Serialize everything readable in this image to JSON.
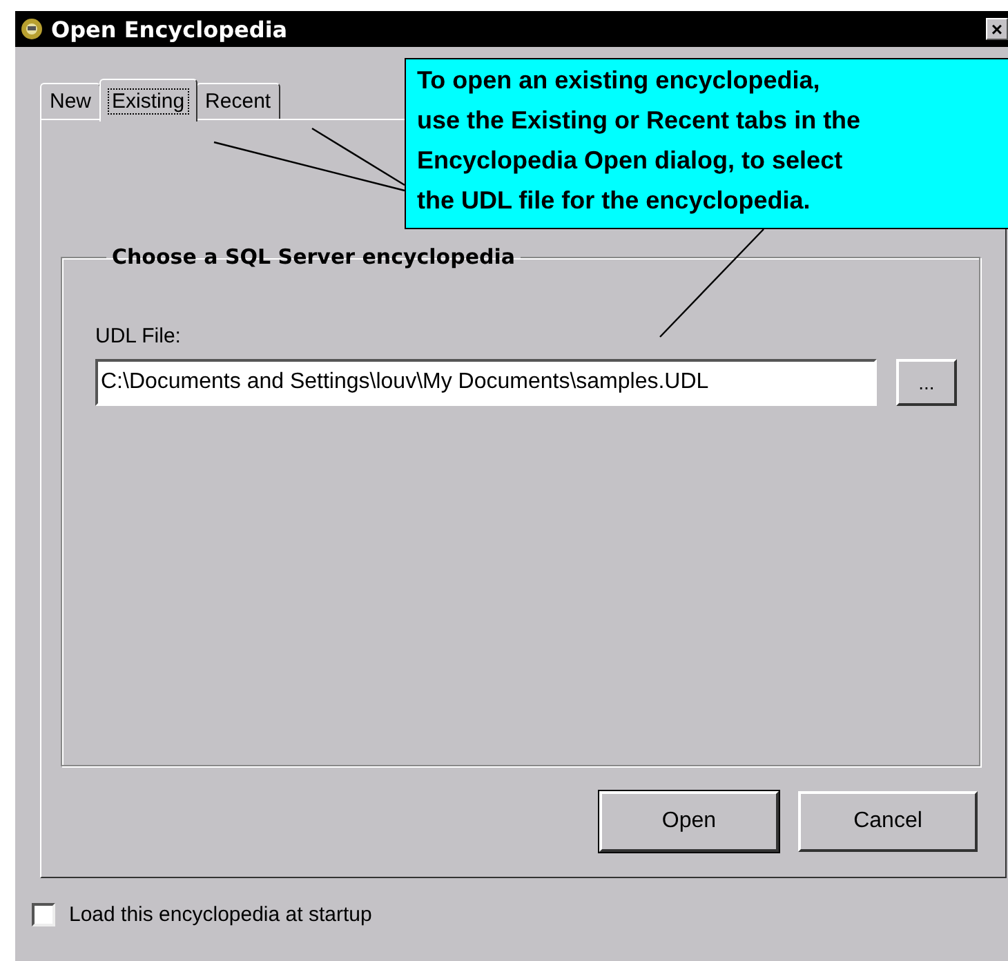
{
  "window": {
    "title": "Open Encyclopedia",
    "close": "×"
  },
  "tabs": [
    {
      "label": "New",
      "selected": false
    },
    {
      "label": "Existing",
      "selected": true
    },
    {
      "label": "Recent",
      "selected": false
    }
  ],
  "callout": {
    "text": "To open an existing encyclopedia,\nuse the Existing or Recent tabs in the\nEncyclopedia Open dialog, to select\nthe UDL file for the encyclopedia."
  },
  "group": {
    "title": "Choose a SQL Server encyclopedia",
    "field_label": "UDL File:",
    "value": "C:\\Documents and Settings\\louv\\My Documents\\samples.UDL",
    "browse": "..."
  },
  "buttons": [
    {
      "label": "Open",
      "default": true
    },
    {
      "label": "Cancel",
      "default": false
    }
  ],
  "startup_checkbox": {
    "label": "Load this encyclopedia at startup",
    "checked": false
  }
}
